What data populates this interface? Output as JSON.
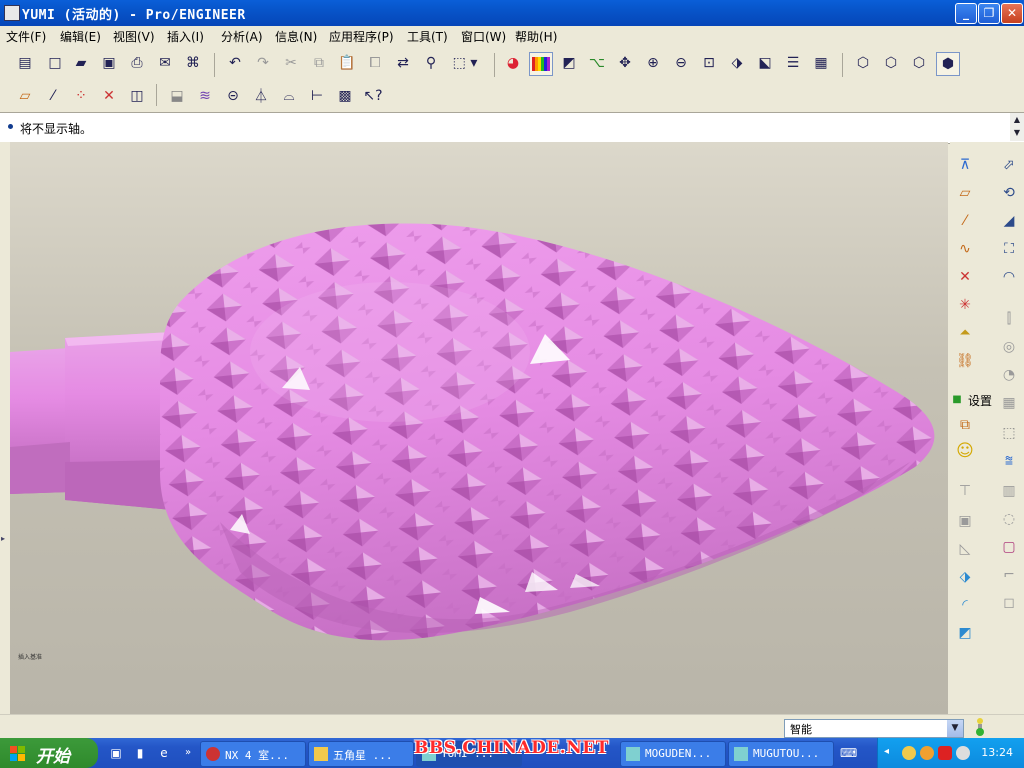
{
  "window": {
    "title": "YUMI (活动的) - Pro/ENGINEER",
    "controls": {
      "minimize": "_",
      "maximize": "❐",
      "close": "✕"
    }
  },
  "menu": [
    {
      "label": "文件(F)"
    },
    {
      "label": "编辑(E)"
    },
    {
      "label": "视图(V)"
    },
    {
      "label": "插入(I)"
    },
    {
      "label": "分析(A)"
    },
    {
      "label": "信息(N)"
    },
    {
      "label": "应用程序(P)"
    },
    {
      "label": "工具(T)"
    },
    {
      "label": "窗口(W)"
    },
    {
      "label": "帮助(H)"
    }
  ],
  "message": {
    "text": "将不显示轴。"
  },
  "viewport": {
    "model_color": "#e58be3",
    "background_top": "#dcd8cb",
    "background_bottom": "#b9b5a9",
    "corner_label": "插入基准"
  },
  "right_toolbar": {
    "settings_label": "设置"
  },
  "status": {
    "filter_value": "智能"
  },
  "taskbar": {
    "start_label": "开始",
    "tasks": [
      {
        "label": "NX 4 室..."
      },
      {
        "label": "五角星 ..."
      },
      {
        "label": "YUMI ..."
      },
      {
        "label": "MOGUDEN..."
      },
      {
        "label": "MUGUTOU..."
      }
    ],
    "clock": "13:24",
    "watermark": "BBS.CHINADE.NET"
  }
}
